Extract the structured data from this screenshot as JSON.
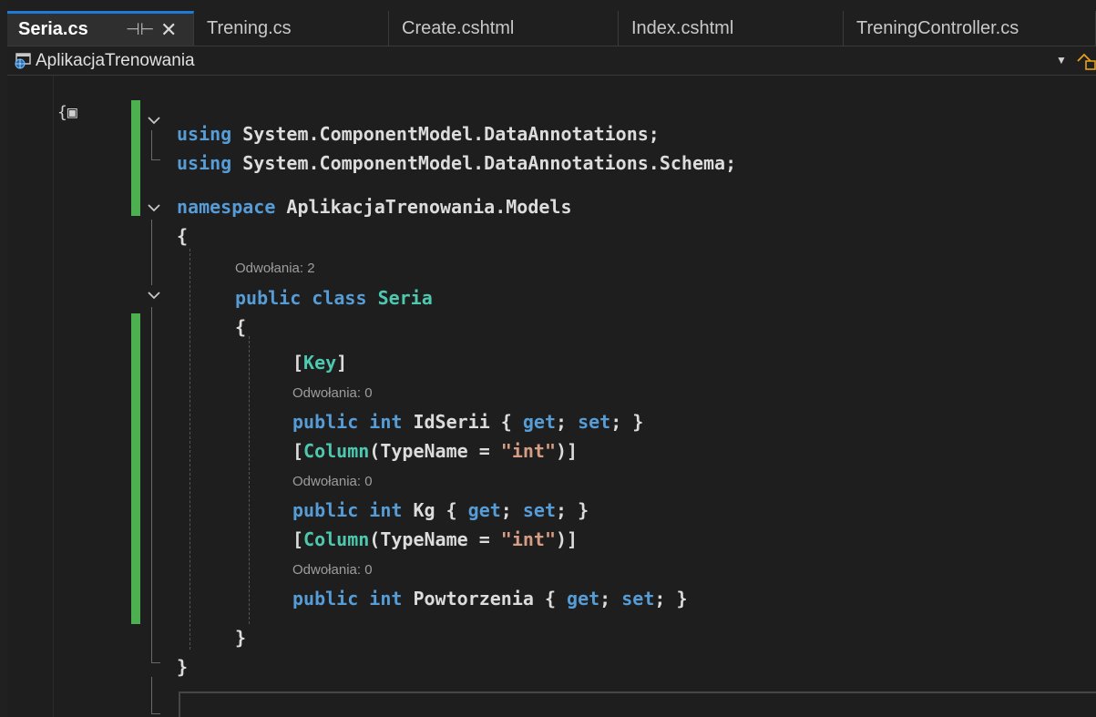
{
  "tabs": [
    {
      "label": "Seria.cs",
      "active": true
    },
    {
      "label": "Trening.cs"
    },
    {
      "label": "Create.cshtml"
    },
    {
      "label": "Index.cshtml"
    },
    {
      "label": "TreningController.cs"
    }
  ],
  "tab_pin_icon": "pin-icon",
  "tab_close_icon": "close-icon",
  "navbar": {
    "project": "AplikacjaTrenowania",
    "project_icon": "web-project-icon",
    "dropdown_icon": "chevron-down-icon",
    "member_icon": "member-icon"
  },
  "code": {
    "l1": {
      "kw": "using",
      "rest": " System.ComponentModel.DataAnnotations;"
    },
    "l2": {
      "kw": "using",
      "rest": " System.ComponentModel.DataAnnotations.Schema;"
    },
    "l3": {
      "kw": "namespace",
      "rest": " AplikacjaTrenowania.Models"
    },
    "l4": "{",
    "lens1": "Odwołania: 2",
    "l5": {
      "kw1": "public",
      "kw2": "class",
      "type": "Seria"
    },
    "l6": "{",
    "l7": {
      "open": "[",
      "type": "Key",
      "close": "]"
    },
    "lens2": "Odwołania: 0",
    "l8": {
      "kw1": "public",
      "kw2": "int",
      "name": " IdSerii { ",
      "get": "get",
      "mid": "; ",
      "set": "set",
      "end": "; }"
    },
    "l9": {
      "open": "[",
      "type": "Column",
      "mid": "(TypeName = ",
      "str": "\"int\"",
      "close": ")]"
    },
    "lens3": "Odwołania: 0",
    "l10": {
      "kw1": "public",
      "kw2": "int",
      "name": " Kg { ",
      "get": "get",
      "mid": "; ",
      "set": "set",
      "end": "; }"
    },
    "l11": {
      "open": "[",
      "type": "Column",
      "mid": "(TypeName = ",
      "str": "\"int\"",
      "close": ")]"
    },
    "lens4": "Odwołania: 0",
    "l12": {
      "kw1": "public",
      "kw2": "int",
      "name": " Powtorzenia { ",
      "get": "get",
      "mid": "; ",
      "set": "set",
      "end": "; }"
    },
    "l13": "}",
    "l14": "}"
  },
  "gutter_icon": "code-lens-icon",
  "fold_icon": "chevron-down-icon",
  "colors": {
    "keyword": "#569cd6",
    "type": "#4ec9b0",
    "string": "#d69d85",
    "change_bar": "#4caf50",
    "tab_accent": "#1e7bd8"
  }
}
